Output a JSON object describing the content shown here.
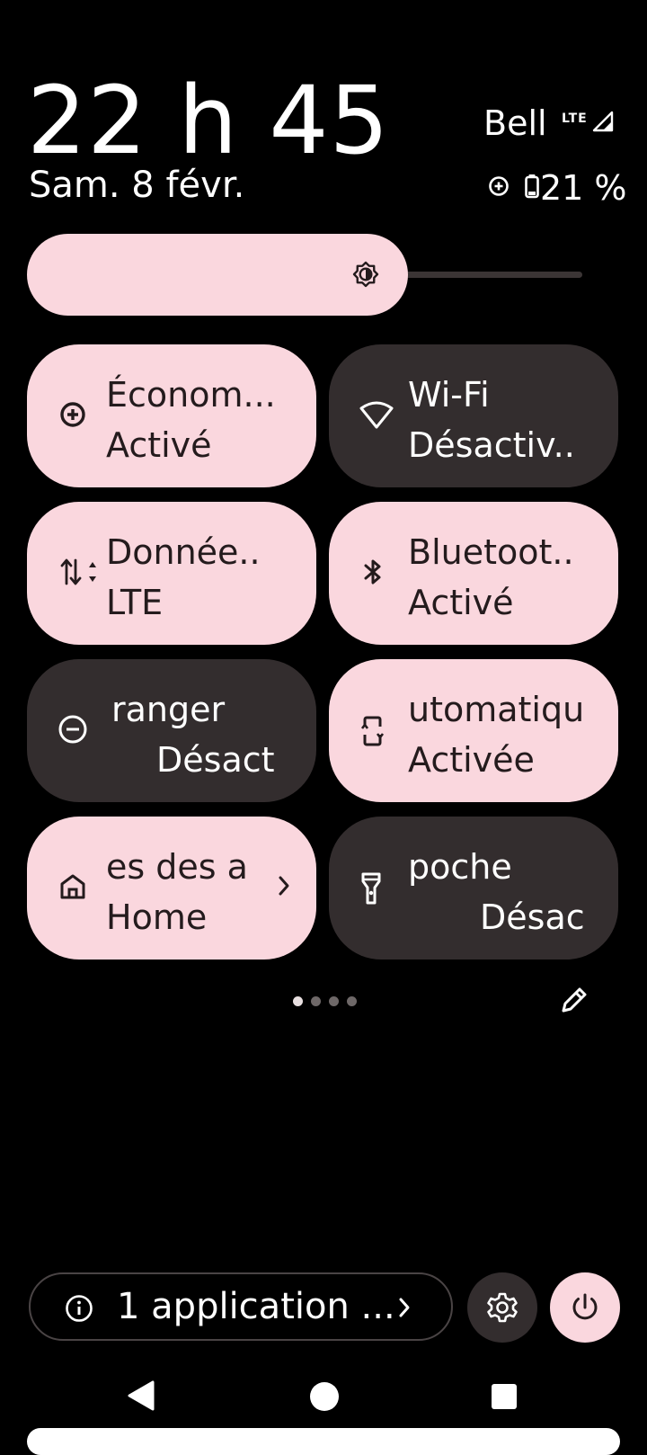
{
  "status": {
    "time": "22 h 45",
    "date": "Sam. 8 févr.",
    "carrier": "Bell",
    "network_type": "LTE",
    "battery_percent": "21 %"
  },
  "brightness": {
    "level": 0.62
  },
  "tiles": [
    {
      "label": "Économ...",
      "state": "Activé",
      "icon": "battery-saver-icon",
      "active": true
    },
    {
      "label": "Wi-Fi",
      "state": "Désactiv..",
      "icon": "wifi-icon",
      "active": false
    },
    {
      "label": "Donnée..",
      "state": "LTE",
      "icon": "mobile-data-icon",
      "active": true
    },
    {
      "label": "Bluetoot..",
      "state": "Activé",
      "icon": "bluetooth-icon",
      "active": true
    },
    {
      "label": "ranger",
      "state": "Désact",
      "icon": "do-not-disturb-icon",
      "active": false
    },
    {
      "label": "utomatiqu",
      "state": "Activée",
      "icon": "auto-rotate-icon",
      "active": true
    },
    {
      "label": "es des a",
      "state": "Home",
      "icon": "home-icon",
      "active": true
    },
    {
      "label": "poche",
      "state": "Désac",
      "icon": "flashlight-icon",
      "active": false
    }
  ],
  "pager": {
    "pages": 4,
    "current": 1
  },
  "footer": {
    "apps_text": "1 application ...",
    "settings_icon": "gear-icon",
    "power_icon": "power-icon"
  },
  "colors": {
    "background": "#000000",
    "tile_on": "#fad7de",
    "tile_off": "#332d2e",
    "text_on": "#241b1d"
  }
}
